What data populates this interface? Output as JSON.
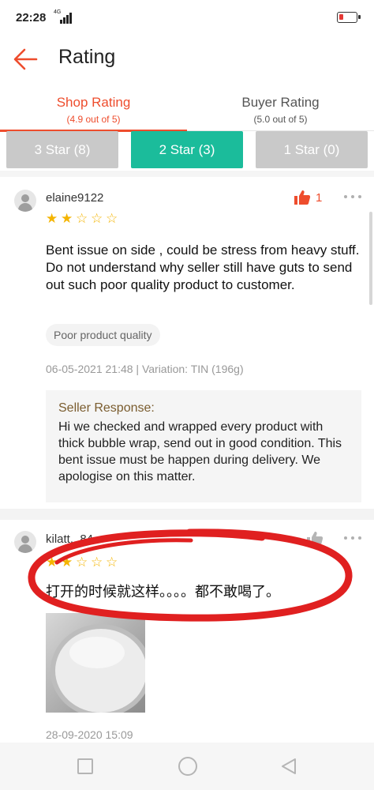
{
  "status_bar": {
    "time": "22:28",
    "network": "4G"
  },
  "header": {
    "title": "Rating"
  },
  "tabs": [
    {
      "label": "Shop Rating",
      "sub": "(4.9 out of 5)",
      "active": true
    },
    {
      "label": "Buyer Rating",
      "sub": "(5.0 out of 5)",
      "active": false
    }
  ],
  "filters": [
    {
      "label": "3 Star (8)",
      "active": false
    },
    {
      "label": "2 Star (3)",
      "active": true
    },
    {
      "label": "1 Star (0)",
      "active": false
    }
  ],
  "reviews": [
    {
      "username": "elaine9122",
      "stars": 2,
      "likes": "1",
      "liked": true,
      "text": "Bent issue on side , could be stress from heavy stuff. Do not understand why seller still have guts to send out such poor quality product to customer.",
      "tag": "Poor product quality",
      "meta": "06-05-2021 21:48 | Variation: TIN (196g)",
      "seller_response": {
        "title": "Seller Response:",
        "text": "Hi we checked and wrapped every product with thick bubble wrap, send out in good condition. This bent issue must be happen during delivery. We apologise on this matter."
      }
    },
    {
      "username": "kilatt...84",
      "stars": 2,
      "liked": false,
      "text": "打开的时候就这样。。。。都不敢喝了。",
      "meta": "28-09-2020 15:09"
    }
  ],
  "colors": {
    "accent": "#ee4d2d",
    "filter_active": "#1bbc9b",
    "filter_inactive": "#c9c9c9",
    "star": "#f4b400",
    "annotation": "#e02020"
  },
  "icons": {
    "back": "arrow-left-icon",
    "like": "thumbs-up-icon",
    "more": "more-dots-icon",
    "avatar": "user-avatar-icon"
  }
}
